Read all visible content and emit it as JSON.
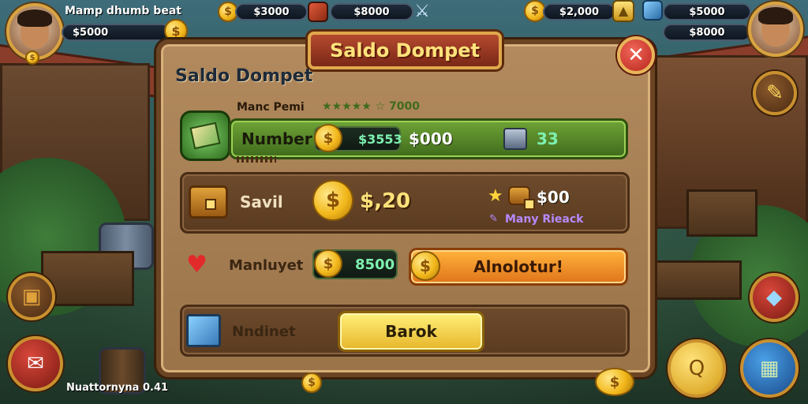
{
  "hud": {
    "player_name": "Mamp dhumb beat",
    "player_coins": "$5000",
    "coins_top": "$3000",
    "gems_top": "$8000",
    "right_value_1": "$2,000",
    "right_value_2": "$5000",
    "right_value_3": "$8000"
  },
  "dialog": {
    "banner_title": "Saldo Dompet",
    "panel_title": "Saldo Dompet",
    "close_symbol": "✕",
    "header": {
      "label": "Manc Pemi",
      "stars_text": "★★★★★ ☆ 7000"
    },
    "row_number": {
      "label": "Number",
      "coin_value": "$3553",
      "amount": "$000",
      "chest_count": "33"
    },
    "row_saldo": {
      "label": "Savil",
      "value": "$,20",
      "star_value": "$00",
      "sub_label": "Many Rieack"
    },
    "row_market": {
      "label": "Manluyet",
      "coin_value": "8500",
      "button_label": "Alnolotur!"
    },
    "row_bottom": {
      "label": "Nndinet",
      "button_label": "Barok"
    }
  },
  "bottom_left_text": "Nuattornyna 0.41",
  "icons": {
    "coin": "coin-icon",
    "gem": "gem-icon",
    "heart": "heart-icon",
    "chest": "treasure-chest-icon",
    "map": "map-icon",
    "close": "close-icon",
    "search": "search-icon"
  }
}
